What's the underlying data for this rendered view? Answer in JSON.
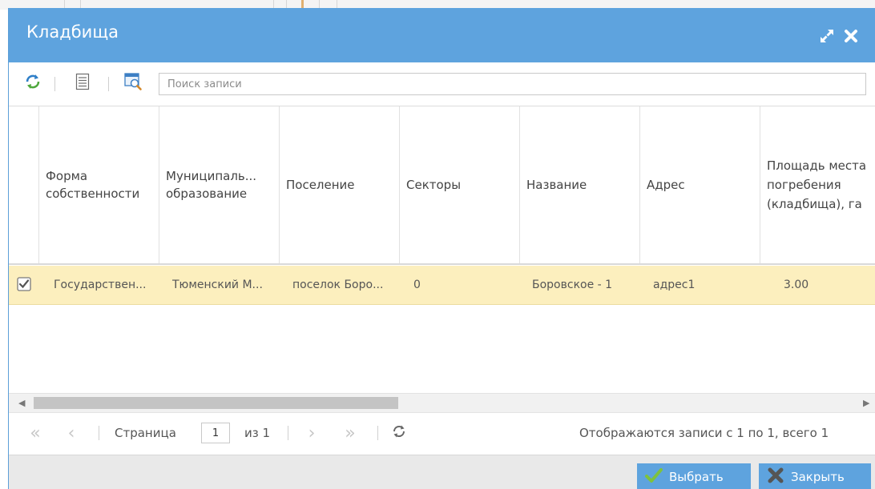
{
  "window": {
    "title": "Кладбища"
  },
  "toolbar": {
    "search_placeholder": "Поиск записи",
    "search_value": ""
  },
  "grid": {
    "columns": [
      "Форма собственности",
      "Муниципаль... образование",
      "Поселение",
      "Секторы",
      "Название",
      "Адрес",
      "Площадь места погребения (кладбища), га"
    ],
    "rows": [
      {
        "selected": true,
        "cells": [
          "Государствен...",
          "Тюменский М...",
          "поселок Боро...",
          "0",
          "Боровское - 1",
          "адрес1",
          "3.00"
        ]
      }
    ]
  },
  "pager": {
    "page_label": "Страница",
    "page_value": "1",
    "of_label": "из 1",
    "summary": "Отображаются записи с 1 по 1, всего 1"
  },
  "footer": {
    "select_label": "Выбрать",
    "close_label": "Закрыть"
  },
  "colors": {
    "titlebar": "#5ea3de",
    "selected_row": "#fcefbe",
    "button": "#5ea3de"
  }
}
